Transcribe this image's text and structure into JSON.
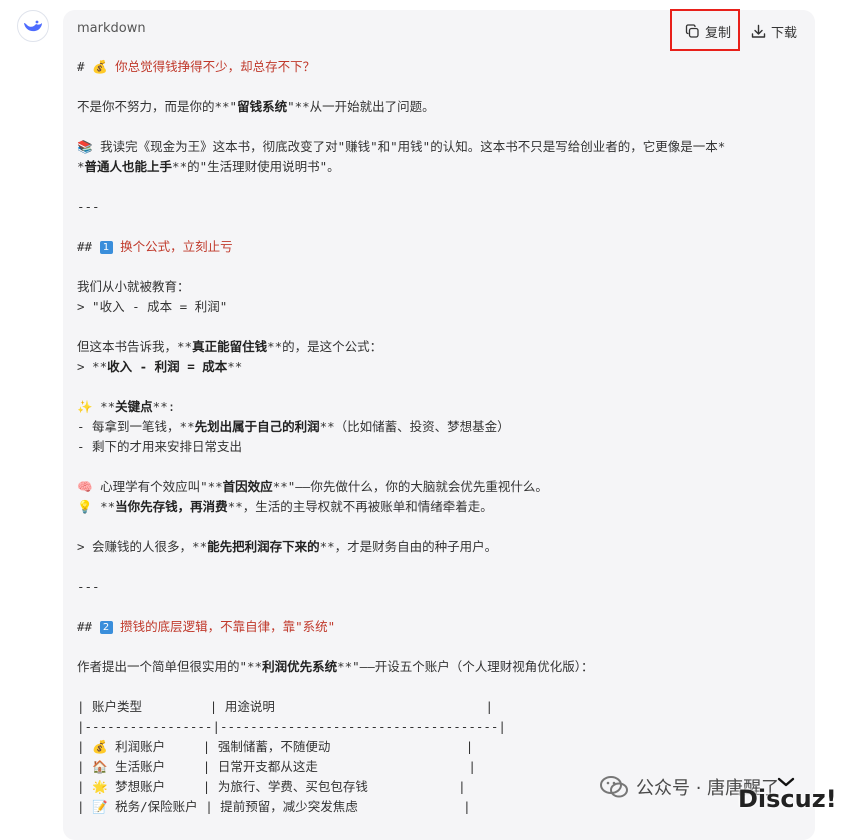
{
  "header": {
    "language": "markdown",
    "copy_label": "复制",
    "download_label": "下载"
  },
  "icons": {
    "avatar": "deepseek-whale-icon",
    "copy": "copy-icon",
    "download": "download-icon",
    "scroll": "chevron-down-icon"
  },
  "code_lines": [
    [
      {
        "t": "# "
      },
      {
        "t": "💰 你总觉得钱挣得不少，却总存不下？",
        "c": "red"
      }
    ],
    [],
    [
      {
        "t": "不是你不努力，而是你的**\""
      },
      {
        "t": "留钱系统",
        "c": "bold"
      },
      {
        "t": "\"**从一开始就出了问题。"
      }
    ],
    [],
    [
      {
        "t": "📚 我读完《现金为王》这本书，彻底改变了对\"赚钱\"和\"用钱\"的认知。这本书不只是写给创业者的，它更像是一本*"
      }
    ],
    [
      {
        "t": "*"
      },
      {
        "t": "普通人也能上手",
        "c": "bold"
      },
      {
        "t": "**的\"生活理财使用说明书\"。"
      }
    ],
    [],
    [
      {
        "t": "---"
      }
    ],
    [],
    [
      {
        "t": "## "
      },
      {
        "t": "1",
        "c": "badge"
      },
      {
        "t": " 换个公式，立刻止亏",
        "c": "red"
      }
    ],
    [],
    [
      {
        "t": "我们从小就被教育："
      }
    ],
    [
      {
        "t": "> \"收入 - 成本 = 利润\""
      }
    ],
    [],
    [
      {
        "t": "但这本书告诉我，**"
      },
      {
        "t": "真正能留住钱",
        "c": "bold"
      },
      {
        "t": "**的，是这个公式："
      }
    ],
    [
      {
        "t": "> **"
      },
      {
        "t": "收入 - 利润 = 成本",
        "c": "bold"
      },
      {
        "t": "**"
      }
    ],
    [],
    [
      {
        "t": "✨ **"
      },
      {
        "t": "关键点",
        "c": "bold"
      },
      {
        "t": "**:"
      }
    ],
    [
      {
        "t": "- 每拿到一笔钱，**"
      },
      {
        "t": "先划出属于自己的利润",
        "c": "bold"
      },
      {
        "t": "**（比如储蓄、投资、梦想基金）"
      }
    ],
    [
      {
        "t": "- 剩下的才用来安排日常支出"
      }
    ],
    [],
    [
      {
        "t": "🧠 心理学有个效应叫\"**"
      },
      {
        "t": "首因效应",
        "c": "bold"
      },
      {
        "t": "**\"——你先做什么，你的大脑就会优先重视什么。"
      }
    ],
    [
      {
        "t": "💡 **"
      },
      {
        "t": "当你先存钱，再消费",
        "c": "bold"
      },
      {
        "t": "**，生活的主导权就不再被账单和情绪牵着走。"
      }
    ],
    [],
    [
      {
        "t": "> 会赚钱的人很多，**"
      },
      {
        "t": "能先把利润存下来的",
        "c": "bold"
      },
      {
        "t": "**，才是财务自由的种子用户。"
      }
    ],
    [],
    [
      {
        "t": "---"
      }
    ],
    [],
    [
      {
        "t": "## "
      },
      {
        "t": "2",
        "c": "badge"
      },
      {
        "t": " 攒钱的底层逻辑，不靠自律，靠\"系统\"",
        "c": "red"
      }
    ],
    [],
    [
      {
        "t": "作者提出一个简单但很实用的\"**"
      },
      {
        "t": "利润优先系统",
        "c": "bold"
      },
      {
        "t": "**\"——开设五个账户（个人理财视角优化版）："
      }
    ],
    [],
    [
      {
        "t": "| 账户类型         | 用途说明                            |"
      }
    ],
    [
      {
        "t": "|-----------------|-------------------------------------|"
      }
    ],
    [
      {
        "t": "| 💰 利润账户     | 强制储蓄，不随便动                  |"
      }
    ],
    [
      {
        "t": "| 🏠 生活账户     | 日常开支都从这走                    |"
      }
    ],
    [
      {
        "t": "| 🌟 梦想账户     | 为旅行、学费、买包包存钱            |"
      }
    ],
    [
      {
        "t": "| 📝 税务/保险账户 | 提前预留，减少突发焦虑              |"
      }
    ]
  ],
  "watermark": {
    "text": "公众号 · 唐唐醒了",
    "site": "Discuz!"
  }
}
